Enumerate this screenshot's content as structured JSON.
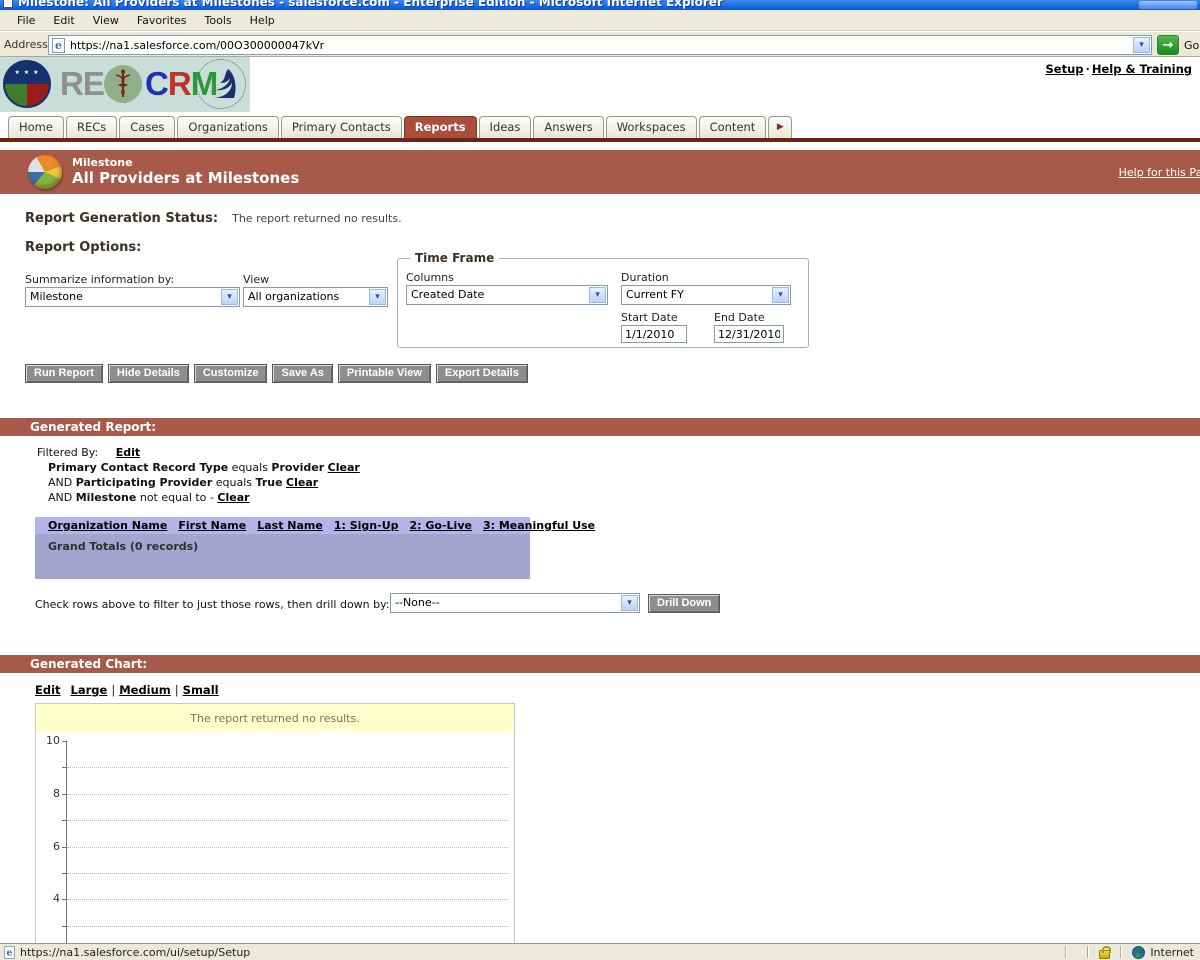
{
  "window": {
    "title": "Milestone: All Providers at Milestones - salesforce.com - Enterprise Edition - Microsoft Internet Explorer",
    "menu": [
      "File",
      "Edit",
      "View",
      "Favorites",
      "Tools",
      "Help"
    ],
    "address_label": "Address",
    "url": "https://na1.salesforce.com/00O300000047kVr",
    "go_label": "Go",
    "status_url": "https://na1.salesforce.com/ui/setup/Setup",
    "status_zone": "Internet"
  },
  "branding": {
    "rec": "REC",
    "crm_c": "C",
    "crm_r": "R",
    "crm_m": "M",
    "setup_link": "Setup",
    "link_separator": "·",
    "help_training_link": "Help & Training"
  },
  "icons": {
    "more_tabs": "▶",
    "go_arrow": "→",
    "dropdown_chevron": "▾"
  },
  "tabs": [
    {
      "label": "Home",
      "active": false
    },
    {
      "label": "RECs",
      "active": false
    },
    {
      "label": "Cases",
      "active": false
    },
    {
      "label": "Organizations",
      "active": false
    },
    {
      "label": "Primary Contacts",
      "active": false
    },
    {
      "label": "Reports",
      "active": true
    },
    {
      "label": "Ideas",
      "active": false
    },
    {
      "label": "Answers",
      "active": false
    },
    {
      "label": "Workspaces",
      "active": false
    },
    {
      "label": "Content",
      "active": false
    }
  ],
  "page_header": {
    "record_type": "Milestone",
    "title": "All Providers at Milestones",
    "help_link": "Help for this Page"
  },
  "report_status": {
    "label": "Report Generation Status:",
    "message": "The report returned no results."
  },
  "report_options": {
    "heading": "Report Options:",
    "summarize": {
      "label": "Summarize information by:",
      "value": "Milestone"
    },
    "view": {
      "label": "View",
      "value": "All organizations"
    },
    "time_frame": {
      "legend": "Time Frame",
      "columns": {
        "label": "Columns",
        "value": "Created Date"
      },
      "duration": {
        "label": "Duration",
        "value": "Current FY"
      },
      "start_date": {
        "label": "Start Date",
        "value": "1/1/2010"
      },
      "end_date": {
        "label": "End Date",
        "value": "12/31/2010"
      }
    }
  },
  "toolbar": {
    "buttons": [
      "Run Report",
      "Hide Details",
      "Customize",
      "Save As",
      "Printable View",
      "Export Details"
    ]
  },
  "generated_report": {
    "heading": "Generated Report:",
    "filtered_by_label": "Filtered By:",
    "edit_link": "Edit",
    "filters": [
      {
        "prefix": "",
        "field": "Primary Contact Record Type",
        "operator": "equals",
        "value": "Provider",
        "clear_link": "Clear"
      },
      {
        "prefix": "AND",
        "field": "Participating Provider",
        "operator": "equals",
        "value": "True",
        "clear_link": "Clear"
      },
      {
        "prefix": "AND",
        "field": "Milestone",
        "operator": "not equal to",
        "value": "-",
        "clear_link": "Clear"
      }
    ],
    "table": {
      "columns": [
        "Organization Name",
        "First Name",
        "Last Name",
        "1: Sign-Up",
        "2: Go-Live",
        "3: Meaningful Use"
      ],
      "grand_totals": "Grand Totals (0 records)"
    },
    "drill_down": {
      "prompt": "Check rows above to filter to just those rows, then drill down by:",
      "select_value": "--None--",
      "button_label": "Drill Down"
    }
  },
  "generated_chart": {
    "heading": "Generated Chart:",
    "edit_link": "Edit",
    "size_links": [
      "Large",
      "Medium",
      "Small"
    ],
    "size_separator": "|",
    "notice": "The report returned no results."
  },
  "chart_data": {
    "type": "bar",
    "title": "",
    "message": "The report returned no results.",
    "categories": [],
    "values": [],
    "ylim": [
      0,
      10
    ],
    "yticks_labeled": [
      10,
      8,
      6,
      4
    ],
    "yticks_all": [
      10,
      9,
      8,
      7,
      6,
      5,
      4,
      3
    ],
    "grid": "dotted-horizontal",
    "legend": "none"
  },
  "colors": {
    "accent_brick": "#A7594A",
    "tab_active": "#A94E3C",
    "table_header_bg": "#B4B4EA",
    "table_body_bg": "#A4A4CE",
    "notice_bg": "#FFFFCC",
    "logo_panel_bg": "#C9DED8"
  }
}
